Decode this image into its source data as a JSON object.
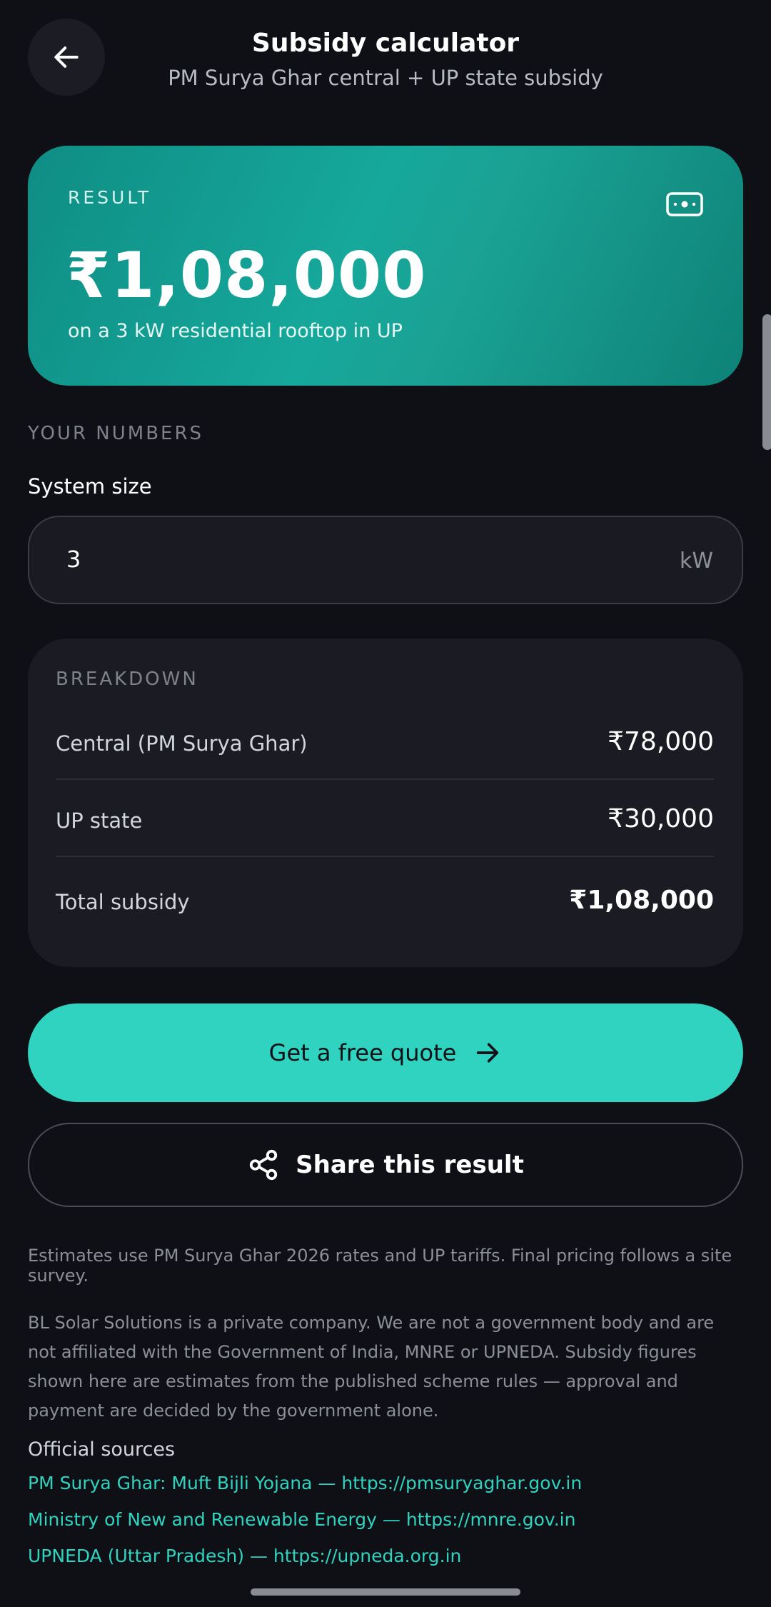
{
  "header": {
    "title": "Subsidy calculator",
    "subtitle": "PM Surya Ghar central + UP state subsidy"
  },
  "result": {
    "label": "RESULT",
    "amount": "₹1,08,000",
    "note": "on a 3 kW residential rooftop in UP"
  },
  "numbers": {
    "section_label": "YOUR NUMBERS",
    "system_size_label": "System size",
    "system_size_value": "3",
    "system_size_unit": "kW"
  },
  "breakdown": {
    "label": "BREAKDOWN",
    "rows": [
      {
        "name": "Central (PM Surya Ghar)",
        "value": "₹78,000"
      },
      {
        "name": "UP state",
        "value": "₹30,000"
      },
      {
        "name": "Total subsidy",
        "value": "₹1,08,000"
      }
    ]
  },
  "actions": {
    "quote_label": "Get a free quote",
    "share_label": "Share this result"
  },
  "footer": {
    "estimate_note": "Estimates use PM Surya Ghar 2026 rates and UP tariffs. Final pricing follows a site survey.",
    "disclaimer": "BL Solar Solutions is a private company. We are not a government body and are not affiliated with the Government of India, MNRE or UPNEDA. Subsidy figures shown here are estimates from the published scheme rules — approval and payment are decided by the government alone.",
    "sources_title": "Official sources",
    "sources": [
      "PM Surya Ghar: Muft Bijli Yojana — https://pmsuryaghar.gov.in",
      "Ministry of New and Renewable Energy — https://mnre.gov.in",
      "UPNEDA (Uttar Pradesh) — https://upneda.org.in"
    ]
  },
  "colors": {
    "accent": "#2fd3bf",
    "background": "#0f1016",
    "card": "#1b1c23",
    "result_card": "#16a89b"
  },
  "icons": {
    "back": "arrow-left-icon",
    "cash": "cash-icon",
    "quote_arrow": "arrow-right-icon",
    "share": "share-icon"
  }
}
